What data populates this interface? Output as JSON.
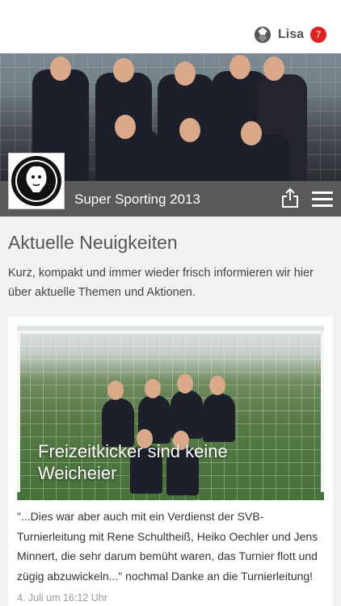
{
  "header": {
    "user_name": "Lisa",
    "notification_count": "7",
    "brand_icon": "club-logo-icon"
  },
  "club": {
    "name": "Super Sporting 2013",
    "logo_icon": "lion-emblem-icon",
    "share_icon": "share-icon",
    "menu_icon": "hamburger-menu-icon"
  },
  "news": {
    "title": "Aktuelle Neuigkeiten",
    "description": "Kurz, kompakt und immer wieder frisch informieren wir hier über aktuelle Themen und Aktionen."
  },
  "articles": [
    {
      "headline": "Freizeitkicker sind keine Weicheier",
      "excerpt": "\"...Dies war aber auch mit ein Verdienst der SVB-Turnierleitung mit Rene Schultheiß, Heiko Oechler und Jens Minnert, die sehr darum bemüht waren, das Turnier flott und zügig abzuwickeln...\" nochmal Danke an die Turnierleitung!",
      "date": "4. Juli um 16:12 Uhr"
    }
  ],
  "colors": {
    "title_bar": "#595959",
    "badge": "#e02020",
    "background": "#f2f2f2"
  }
}
